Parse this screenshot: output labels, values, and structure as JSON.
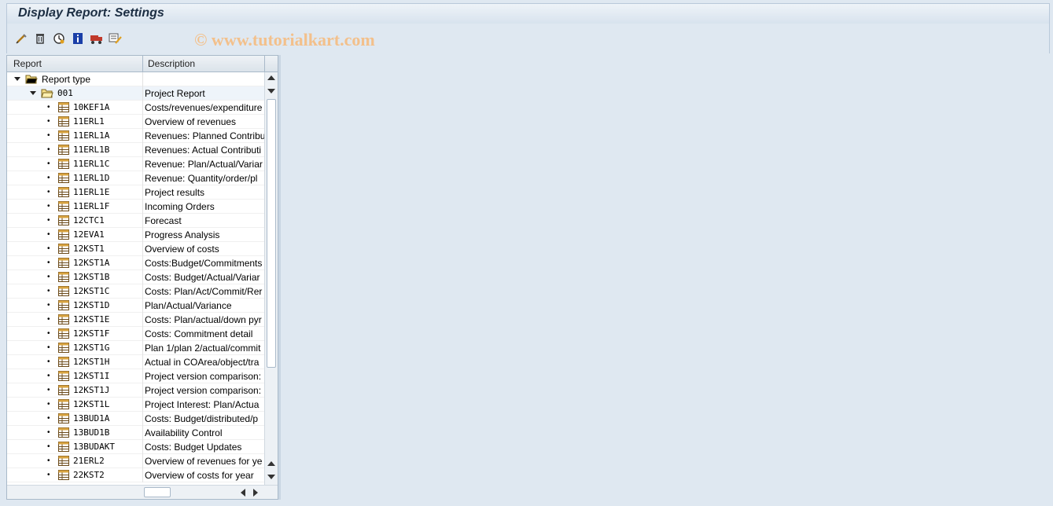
{
  "window": {
    "title": "Display Report: Settings"
  },
  "toolbar": {
    "icons": [
      "change-icon",
      "delete-icon",
      "execute-icon",
      "info-icon",
      "transport-icon",
      "settings-icon"
    ]
  },
  "watermark": "© www.tutorialkart.com",
  "table": {
    "headers": {
      "report": "Report",
      "description": "Description"
    },
    "tree": {
      "root": "Report type",
      "group": "001",
      "group_desc": "Project Report"
    },
    "rows": [
      {
        "name": "10KEF1A",
        "desc": "Costs/revenues/expenditure"
      },
      {
        "name": "11ERL1",
        "desc": "Overview of revenues"
      },
      {
        "name": "11ERL1A",
        "desc": "Revenues: Planned Contribu"
      },
      {
        "name": "11ERL1B",
        "desc": "Revenues: Actual Contributi"
      },
      {
        "name": "11ERL1C",
        "desc": "Revenue: Plan/Actual/Variar"
      },
      {
        "name": "11ERL1D",
        "desc": "Revenue: Quantity/order/pl"
      },
      {
        "name": "11ERL1E",
        "desc": "Project results"
      },
      {
        "name": "11ERL1F",
        "desc": "Incoming Orders"
      },
      {
        "name": "12CTC1",
        "desc": "Forecast"
      },
      {
        "name": "12EVA1",
        "desc": "Progress Analysis"
      },
      {
        "name": "12KST1",
        "desc": "Overview of costs"
      },
      {
        "name": "12KST1A",
        "desc": "Costs:Budget/Commitments"
      },
      {
        "name": "12KST1B",
        "desc": "Costs: Budget/Actual/Variar"
      },
      {
        "name": "12KST1C",
        "desc": "Costs: Plan/Act/Commit/Rer"
      },
      {
        "name": "12KST1D",
        "desc": "Plan/Actual/Variance"
      },
      {
        "name": "12KST1E",
        "desc": "Costs: Plan/actual/down pyr"
      },
      {
        "name": "12KST1F",
        "desc": "Costs: Commitment detail"
      },
      {
        "name": "12KST1G",
        "desc": "Plan 1/plan 2/actual/commit"
      },
      {
        "name": "12KST1H",
        "desc": "Actual in COArea/object/tra"
      },
      {
        "name": "12KST1I",
        "desc": "Project version comparison:"
      },
      {
        "name": "12KST1J",
        "desc": "Project version comparison:"
      },
      {
        "name": "12KST1L",
        "desc": "Project Interest: Plan/Actua"
      },
      {
        "name": "13BUD1A",
        "desc": "Costs: Budget/distributed/p"
      },
      {
        "name": "13BUD1B",
        "desc": "Availability Control"
      },
      {
        "name": "13BUDAKT",
        "desc": "Costs: Budget Updates"
      },
      {
        "name": "21ERL2",
        "desc": "Overview of revenues for ye"
      },
      {
        "name": "22KST2",
        "desc": "Overview of costs for year"
      }
    ]
  },
  "colors": {
    "background": "#dfe8f1",
    "title": "#1c2e43",
    "watermark": "#f3c08b"
  }
}
